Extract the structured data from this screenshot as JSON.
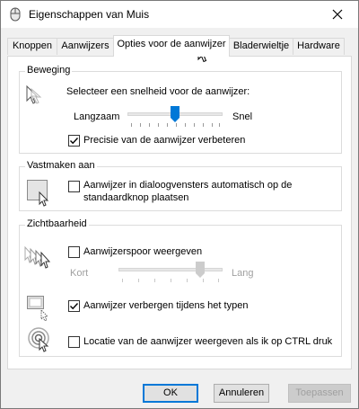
{
  "window": {
    "title": "Eigenschappen van Muis"
  },
  "tabs": [
    {
      "label": "Knoppen"
    },
    {
      "label": "Aanwijzers"
    },
    {
      "label": "Opties voor de aanwijzer"
    },
    {
      "label": "Bladerwieltje"
    },
    {
      "label": "Hardware"
    }
  ],
  "active_tab": "Opties voor de aanwijzer",
  "motion": {
    "group_title": "Beweging",
    "speed_label": "Selecteer een snelheid voor de aanwijzer:",
    "slow_label": "Langzaam",
    "fast_label": "Snel",
    "speed_value": 0.5,
    "precision_label": "Precisie van de aanwijzer verbeteren",
    "precision_checked": true
  },
  "snap": {
    "group_title": "Vastmaken aan",
    "snap_label_line1": "Aanwijzer in dialoogvensters automatisch op de",
    "snap_label_line2": "standaardknop plaatsen",
    "snap_checked": false
  },
  "visibility": {
    "group_title": "Zichtbaarheid",
    "trails_label": "Aanwijzerspoor weergeven",
    "trails_checked": false,
    "short_label": "Kort",
    "long_label": "Lang",
    "trails_value": 1.0,
    "hide_label": "Aanwijzer verbergen tijdens het typen",
    "hide_checked": true,
    "ctrl_label": "Locatie van de aanwijzer weergeven als ik op CTRL druk",
    "ctrl_checked": false
  },
  "buttons": {
    "ok": "OK",
    "cancel": "Annuleren",
    "apply": "Toepassen"
  },
  "colors": {
    "accent": "#0078d7",
    "slider_thumb": "#0078d7",
    "disabled_text": "#a0a0a0"
  }
}
